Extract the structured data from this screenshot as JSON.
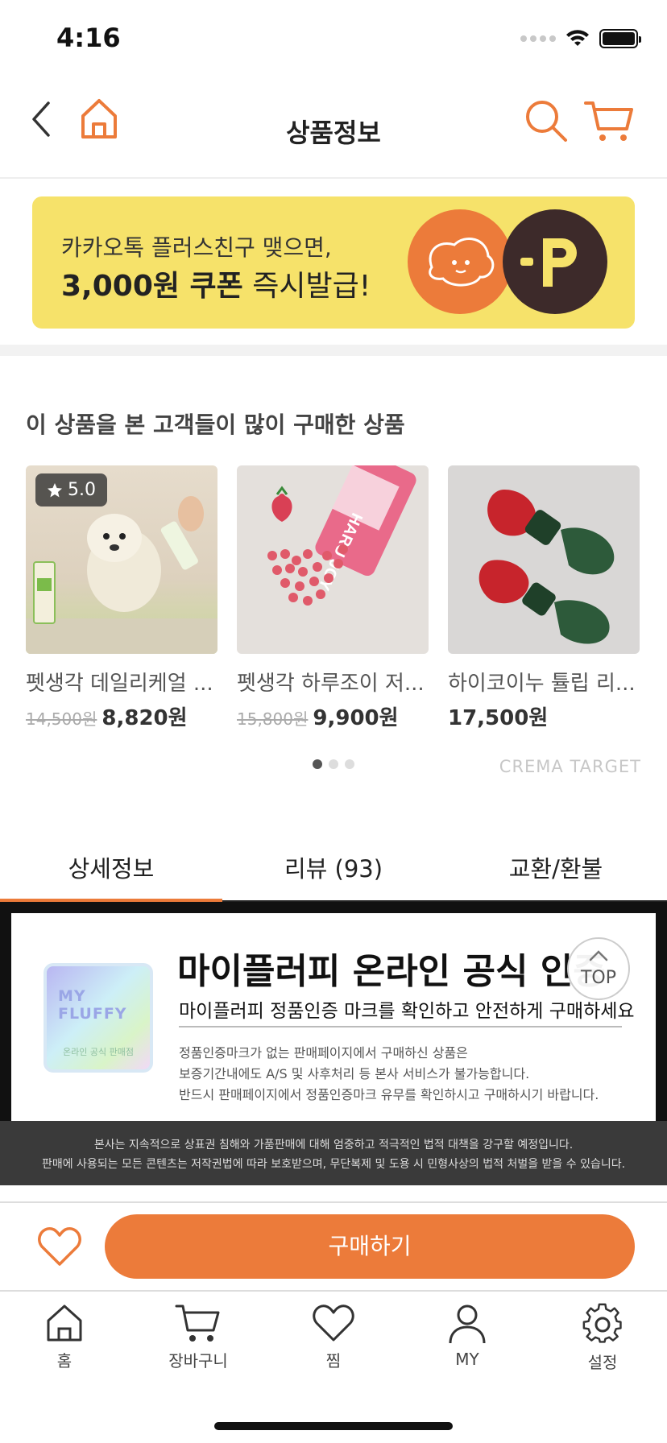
{
  "status_bar": {
    "time": "4:16"
  },
  "header": {
    "title": "상품정보"
  },
  "banner": {
    "line1": "카카오톡 플러스친구 맺으면,",
    "line2_bold": "3,000원 쿠폰",
    "line2_rest": " 즉시발급!",
    "logo_letter": "P"
  },
  "recommend": {
    "title": "이 상품을 본 고객들이 많이 구매한 상품",
    "items": [
      {
        "name": "펫생각 데일리케얼 ...",
        "orig_price": "14,500원",
        "price": "8,820원",
        "rating": "5.0"
      },
      {
        "name": "펫생각 하루조이 저...",
        "orig_price": "15,800원",
        "price": "9,900원"
      },
      {
        "name": "하이코이누 튤립 리...",
        "price": "17,500원"
      }
    ],
    "provider": "CREMA TARGET"
  },
  "tabs": [
    {
      "label": "상세정보"
    },
    {
      "label": "리뷰 (93)"
    },
    {
      "label": "교환/환불"
    }
  ],
  "detail": {
    "holo_title": "MY FLUFFY",
    "holo_sub": "온라인 공식 판매점",
    "heading": "마이플러피 온라인 공식 인증",
    "subheading": "마이플러피 정품인증 마크를 확인하고 안전하게 구매하세요",
    "notice1": "정품인증마크가 없는 판매페이지에서 구매하신 상품은",
    "notice2": "보증기간내에도 A/S 및 사후처리 등 본사 서비스가 불가능합니다.",
    "notice3": "반드시 판매페이지에서 정품인증마크 유무를 확인하시고 구매하시기 바랍니다.",
    "footer1": "본사는 지속적으로 상표권 침해와 가품판매에 대해 엄중하고 적극적인 법적 대책을 강구할 예정입니다.",
    "footer2": "판매에 사용되는 모든 콘텐츠는 저작권법에 따라 보호받으며, 무단복제 및 도용 시 민형사상의 법적 처벌을 받을 수 있습니다."
  },
  "top_button": "TOP",
  "buy": {
    "label": "구매하기"
  },
  "tabbar": [
    {
      "label": "홈",
      "icon": "home-icon"
    },
    {
      "label": "장바구니",
      "icon": "cart-icon"
    },
    {
      "label": "찜",
      "icon": "heart-icon"
    },
    {
      "label": "MY",
      "icon": "person-icon"
    },
    {
      "label": "설정",
      "icon": "gear-icon"
    }
  ],
  "colors": {
    "accent": "#ec7b3a",
    "banner_bg": "#f6e26a",
    "logo_dark": "#3d2a2a"
  }
}
